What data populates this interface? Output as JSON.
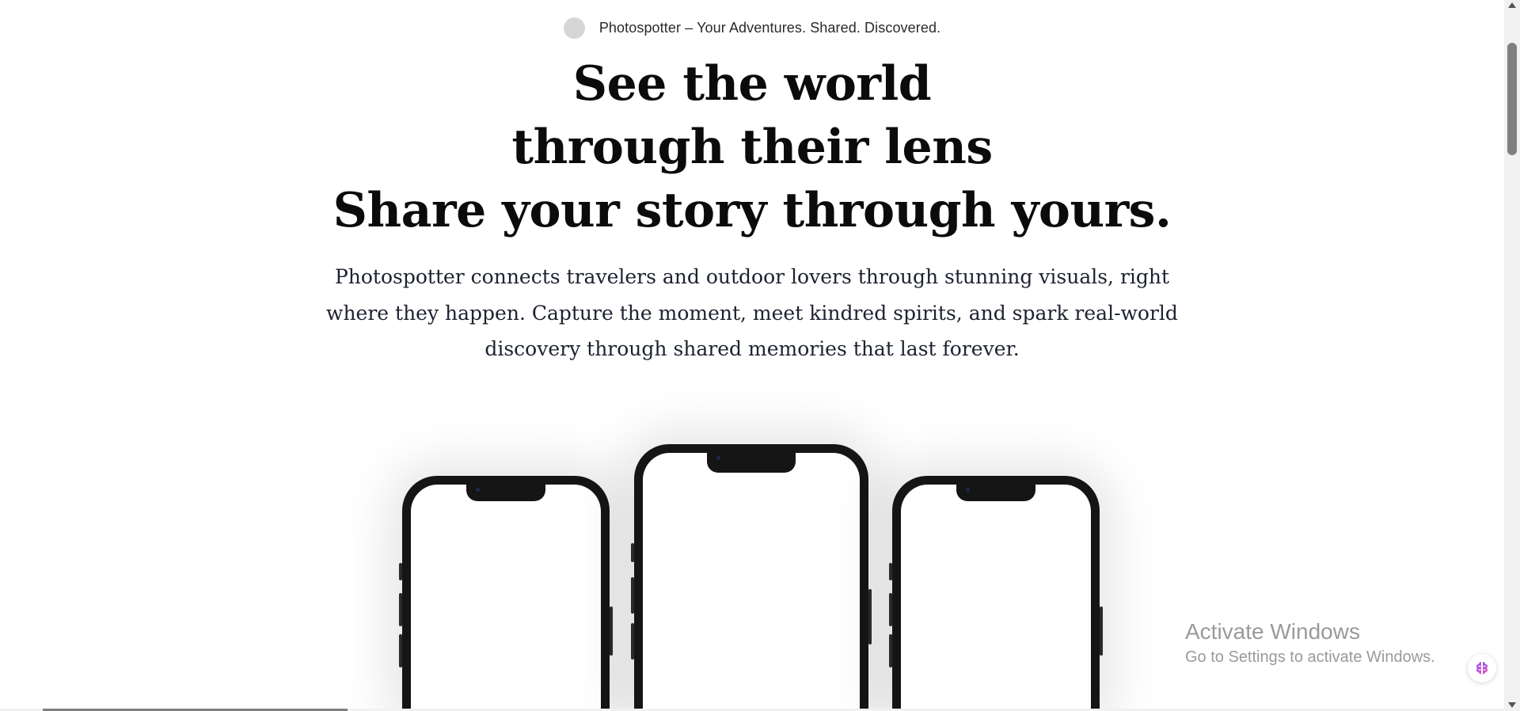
{
  "brand": {
    "tagline": "Photospotter – Your Adventures. Shared. Discovered.",
    "logo_icon": "circle-logo-placeholder"
  },
  "hero": {
    "line1": "See the world",
    "line2": "through their lens",
    "line3": "Share your story through yours."
  },
  "lead": {
    "text": "Photospotter connects travelers and outdoor lovers through stunning visuals, right where they happen. Capture the moment, meet kindred spirits, and spark real-world discovery through shared memories that last forever."
  },
  "phones": {
    "count": 3,
    "icon": "smartphone-mockup"
  },
  "watermark": {
    "title": "Activate Windows",
    "subtitle": "Go to Settings to activate Windows."
  },
  "assistant": {
    "icon": "brain-icon"
  },
  "colors": {
    "background": "#ffffff",
    "heading": "#0b0b0b",
    "body_text": "#1d2230",
    "phone_frame": "#151515"
  }
}
